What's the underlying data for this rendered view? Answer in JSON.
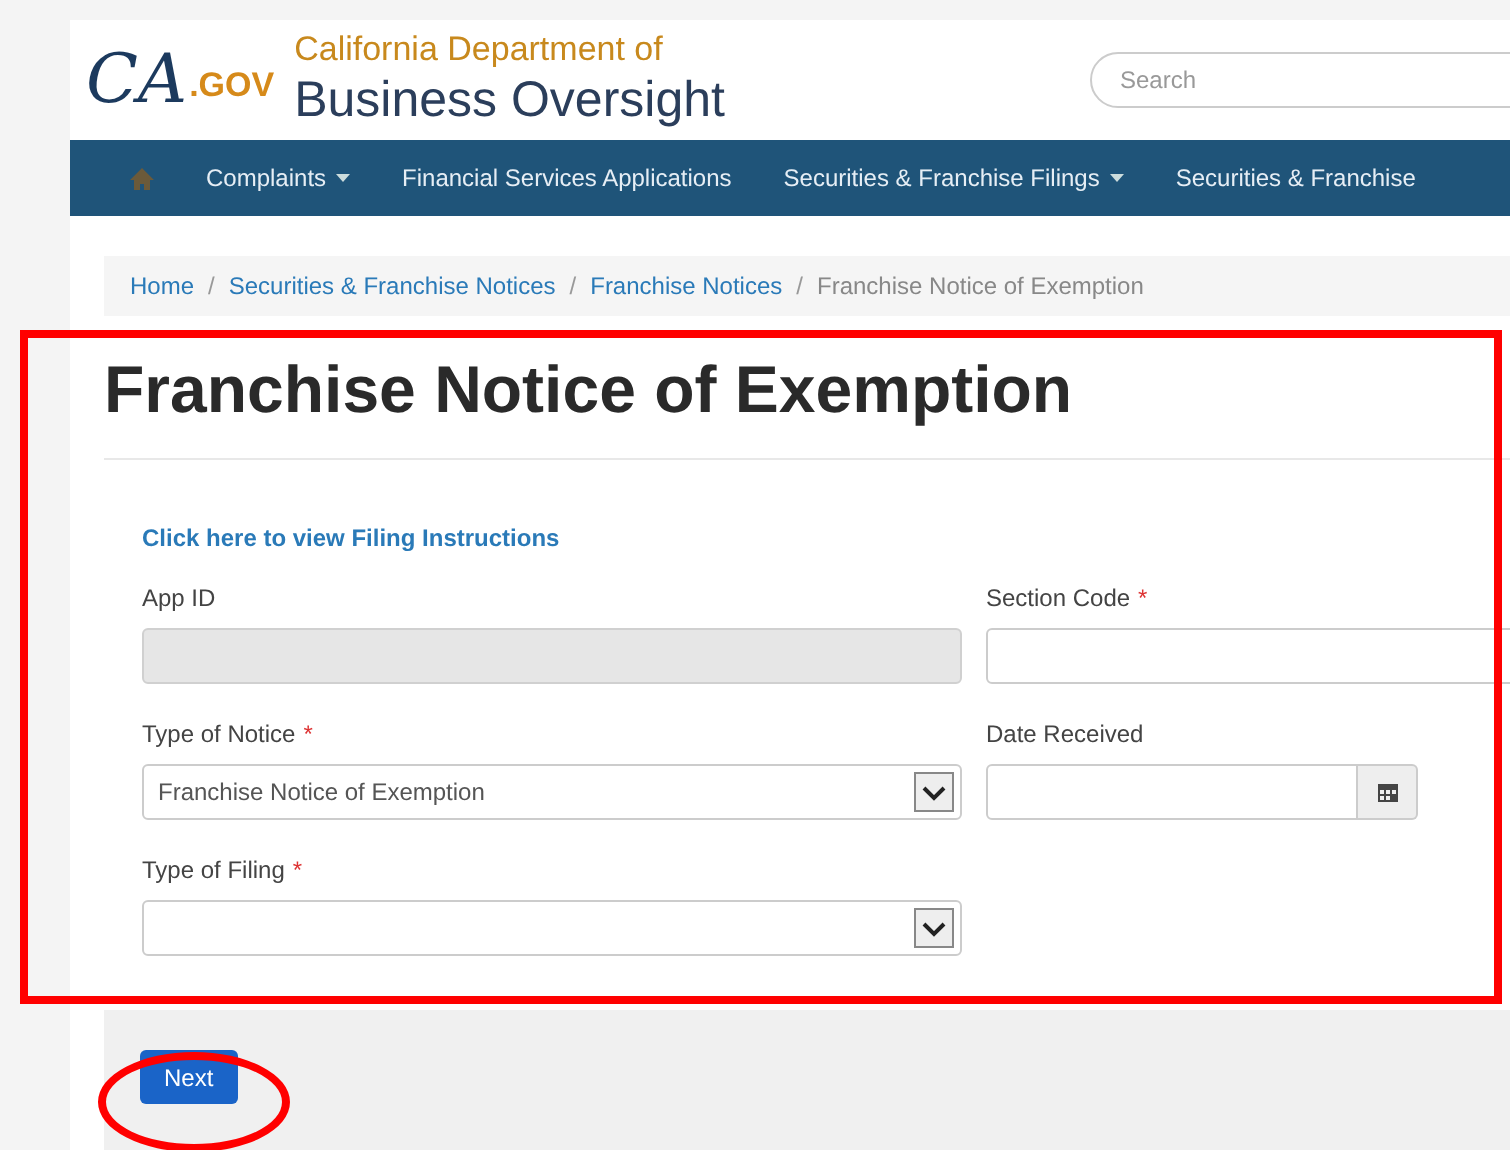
{
  "logo": {
    "mark": "CA",
    "suffix": ".GOV",
    "line1": "California Department of",
    "line2": "Business Oversight"
  },
  "search": {
    "placeholder": "Search"
  },
  "nav": [
    {
      "label": "Complaints",
      "dropdown": true
    },
    {
      "label": "Financial Services Applications",
      "dropdown": false
    },
    {
      "label": "Securities & Franchise Filings",
      "dropdown": true
    },
    {
      "label": "Securities & Franchise",
      "dropdown": false
    }
  ],
  "breadcrumb_separator": "/",
  "breadcrumb": [
    {
      "label": "Home",
      "current": false
    },
    {
      "label": "Securities & Franchise Notices",
      "current": false
    },
    {
      "label": "Franchise Notices",
      "current": false
    },
    {
      "label": "Franchise Notice of Exemption",
      "current": true
    }
  ],
  "title": "Franchise Notice of Exemption",
  "instructions_link": "Click here to view Filing Instructions",
  "left_fields": [
    {
      "label": "App ID",
      "kind": "text",
      "required": false,
      "disabled": true
    },
    {
      "label": "Type of Notice",
      "kind": "select",
      "required": true,
      "value": "Franchise Notice of Exemption"
    },
    {
      "label": "Type of Filing",
      "kind": "select",
      "required": true
    }
  ],
  "right_fields": [
    {
      "label": "Section Code",
      "kind": "text",
      "required": true,
      "disabled": false
    },
    {
      "label": "Date Received",
      "kind": "date",
      "required": false
    }
  ],
  "required_mark": "*",
  "next_button": "Next",
  "highlight_form": true,
  "highlight_next_button": true
}
